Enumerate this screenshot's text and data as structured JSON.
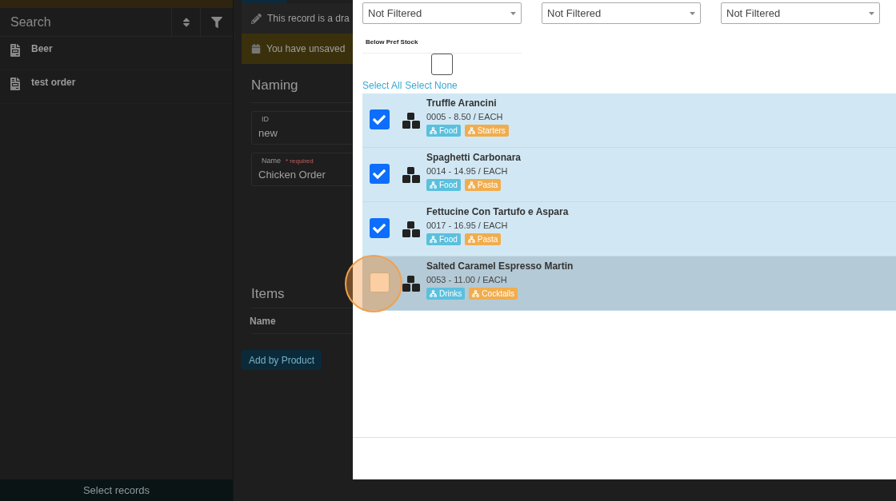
{
  "sidebar": {
    "search": {
      "placeholder": "Search"
    },
    "records": [
      {
        "name": "Beer"
      },
      {
        "name": "test order"
      }
    ],
    "footer_button": "Select records"
  },
  "record": {
    "banners": [
      {
        "kind": "draft",
        "text": "This record is a dra"
      },
      {
        "kind": "unsaved",
        "text": "You have unsaved"
      }
    ],
    "section_title": "Naming",
    "fields": [
      {
        "label": "ID",
        "value": "new"
      },
      {
        "label": "Name",
        "required": "* required",
        "value": "Chicken Order"
      }
    ],
    "items_title": "Items",
    "items_column": "Name",
    "add_button": "Add by Product"
  },
  "modal": {
    "filters": [
      {
        "value": "Not Filtered"
      },
      {
        "value": "Not Filtered"
      },
      {
        "value": "Not Filtered"
      }
    ],
    "below_pref_stock": {
      "label": "Below Pref Stock",
      "checked": false
    },
    "select_all": "Select All",
    "select_none": "Select None",
    "products": [
      {
        "name": "Truffle Arancini",
        "details": "0005 - 8.50 / EACH",
        "selected": true,
        "hovered": false,
        "tags": [
          {
            "label": "Food",
            "color": "#5bc0de"
          },
          {
            "label": "Starters",
            "color": "#f0ad4e"
          }
        ]
      },
      {
        "name": "Spaghetti Carbonara",
        "details": "0014 - 14.95 / EACH",
        "selected": true,
        "hovered": false,
        "tags": [
          {
            "label": "Food",
            "color": "#5bc0de"
          },
          {
            "label": "Pasta",
            "color": "#f0ad4e"
          }
        ]
      },
      {
        "name": "Fettucine Con Tartufo e Aspara",
        "details": "0017 - 16.95 / EACH",
        "selected": true,
        "hovered": false,
        "tags": [
          {
            "label": "Food",
            "color": "#5bc0de"
          },
          {
            "label": "Pasta",
            "color": "#f0ad4e"
          }
        ]
      },
      {
        "name": "Salted Caramel Espresso Martin",
        "details": "0053 - 11.00 / EACH",
        "selected": false,
        "hovered": true,
        "tags": [
          {
            "label": "Drinks",
            "color": "#5bc0de"
          },
          {
            "label": "Cocktails",
            "color": "#f0ad4e"
          }
        ]
      }
    ]
  }
}
